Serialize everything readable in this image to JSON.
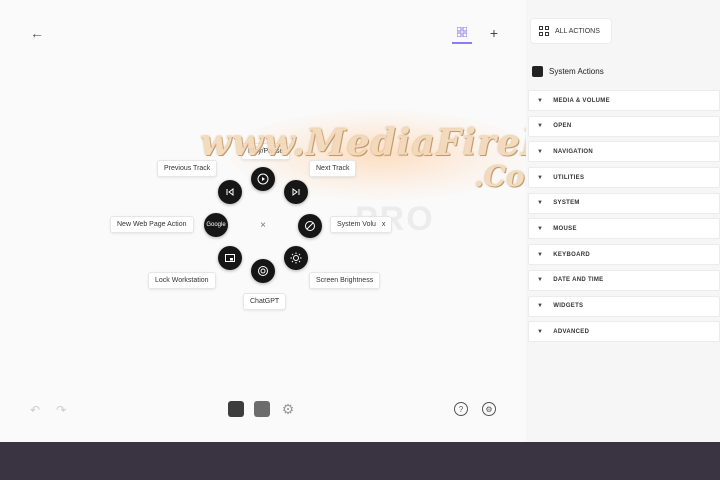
{
  "watermark": {
    "text": "www.MediaFirePC",
    "tail": ".Com"
  },
  "background_ghost": "PRO",
  "radial_menu": {
    "nodes": [
      {
        "name": "play-pause-node",
        "icon": "play-icon",
        "label": "Play/Pause"
      },
      {
        "name": "next-track-node",
        "icon": "skip-next-icon",
        "label": "Next Track"
      },
      {
        "name": "system-volume-node",
        "icon": "volume-icon",
        "label": "System Volu",
        "label_suffix": "x"
      },
      {
        "name": "screen-brightness-node",
        "icon": "brightness-icon",
        "label": "Screen Brightness"
      },
      {
        "name": "chatgpt-node",
        "icon": "chatgpt-icon",
        "label": "ChatGPT"
      },
      {
        "name": "lock-workstation-node",
        "icon": "lock-screen-icon",
        "label": "Lock Workstation"
      },
      {
        "name": "web-page-node",
        "icon": "google-icon",
        "icon_text": "Google",
        "label": "New Web Page Action"
      },
      {
        "name": "previous-track-node",
        "icon": "skip-previous-icon",
        "label": "Previous Track"
      }
    ],
    "center_icon": "close-icon",
    "center_symbol": "×"
  },
  "panel": {
    "all_actions": "ALL ACTIONS",
    "system_actions": "System Actions",
    "categories": [
      "MEDIA & VOLUME",
      "OPEN",
      "NAVIGATION",
      "UTILITIES",
      "SYSTEM",
      "MOUSE",
      "KEYBOARD",
      "DATE AND TIME",
      "WIDGETS",
      "ADVANCED"
    ]
  },
  "toolbar": {
    "back_symbol": "←",
    "plus_symbol": "+",
    "undo_symbol": "↶",
    "redo_symbol": "↷",
    "gear_symbol": "⚙",
    "help_symbol": "?",
    "settings_symbol": "⚙"
  },
  "colors": {
    "accent": "#8b7cf0",
    "node": "#161616",
    "bottom_bar": "#3a3341"
  }
}
